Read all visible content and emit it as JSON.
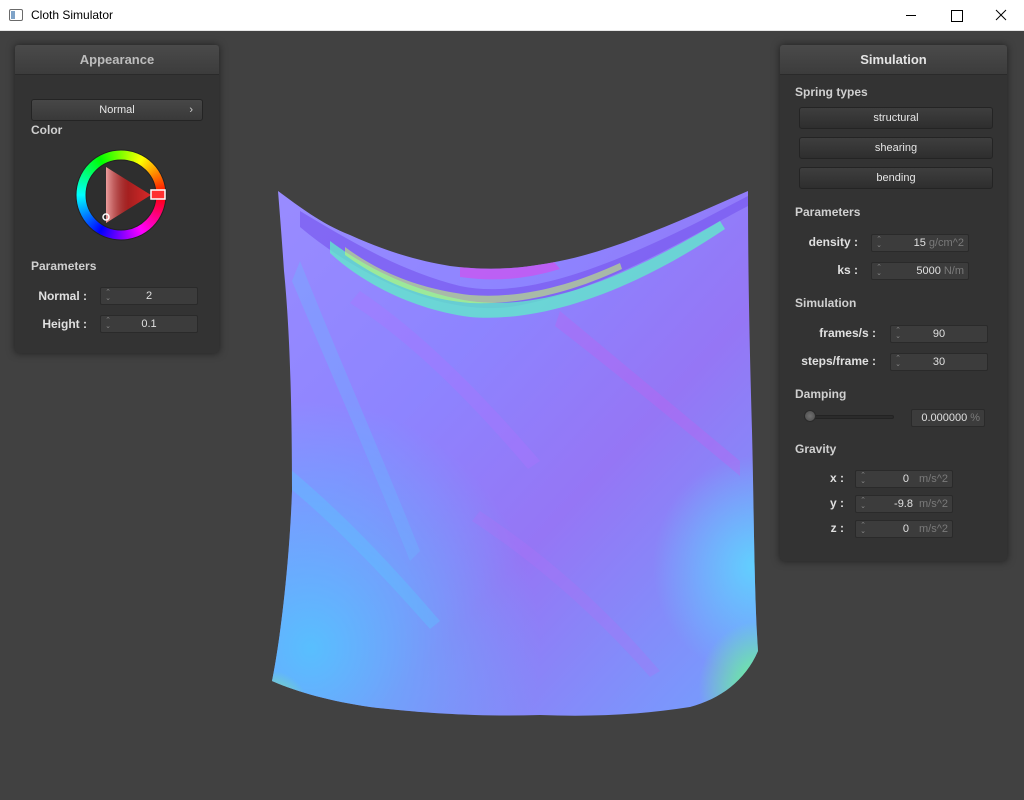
{
  "window": {
    "title": "Cloth Simulator"
  },
  "appearance": {
    "header": "Appearance",
    "shader_select": {
      "label": "Normal",
      "chevron": "›"
    },
    "color_label": "Color",
    "color_picker": {
      "hue_marker_color": "#ff2020",
      "triangle_color": "#d62828"
    },
    "parameters_label": "Parameters",
    "normal": {
      "label": "Normal :",
      "value": "2"
    },
    "height": {
      "label": "Height :",
      "value": "0.1"
    }
  },
  "simulation": {
    "header": "Simulation",
    "spring_types_label": "Spring types",
    "spring_buttons": [
      "structural",
      "shearing",
      "bending"
    ],
    "parameters_label": "Parameters",
    "density": {
      "label": "density :",
      "value": "15",
      "unit": "g/cm^2"
    },
    "ks": {
      "label": "ks :",
      "value": "5000",
      "unit": "N/m"
    },
    "simulation_label": "Simulation",
    "frames_per_s": {
      "label": "frames/s :",
      "value": "90"
    },
    "steps_per_frame": {
      "label": "steps/frame :",
      "value": "30"
    },
    "damping_label": "Damping",
    "damping": {
      "value": "0.000000",
      "unit": "%",
      "fraction": 0
    },
    "gravity_label": "Gravity",
    "gravity_x": {
      "label": "x :",
      "value": "0",
      "unit": "m/s^2"
    },
    "gravity_y": {
      "label": "y :",
      "value": "-9.8",
      "unit": "m/s^2"
    },
    "gravity_z": {
      "label": "z :",
      "value": "0",
      "unit": "m/s^2"
    }
  },
  "viewport": {
    "background": "#414141",
    "cloth_colors": [
      "#8a7cff",
      "#5fb0ff",
      "#b06cf0",
      "#4ee6d8",
      "#7dff7a"
    ]
  }
}
